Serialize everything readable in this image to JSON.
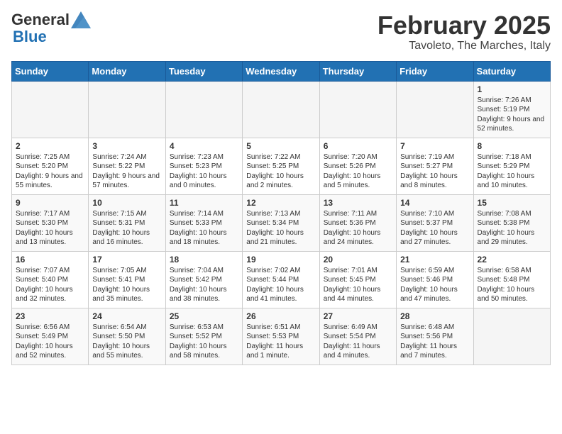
{
  "logo": {
    "general": "General",
    "blue": "Blue"
  },
  "header": {
    "title": "February 2025",
    "subtitle": "Tavoleto, The Marches, Italy"
  },
  "weekdays": [
    "Sunday",
    "Monday",
    "Tuesday",
    "Wednesday",
    "Thursday",
    "Friday",
    "Saturday"
  ],
  "weeks": [
    [
      {
        "day": "",
        "info": ""
      },
      {
        "day": "",
        "info": ""
      },
      {
        "day": "",
        "info": ""
      },
      {
        "day": "",
        "info": ""
      },
      {
        "day": "",
        "info": ""
      },
      {
        "day": "",
        "info": ""
      },
      {
        "day": "1",
        "info": "Sunrise: 7:26 AM\nSunset: 5:19 PM\nDaylight: 9 hours and 52 minutes."
      }
    ],
    [
      {
        "day": "2",
        "info": "Sunrise: 7:25 AM\nSunset: 5:20 PM\nDaylight: 9 hours and 55 minutes."
      },
      {
        "day": "3",
        "info": "Sunrise: 7:24 AM\nSunset: 5:22 PM\nDaylight: 9 hours and 57 minutes."
      },
      {
        "day": "4",
        "info": "Sunrise: 7:23 AM\nSunset: 5:23 PM\nDaylight: 10 hours and 0 minutes."
      },
      {
        "day": "5",
        "info": "Sunrise: 7:22 AM\nSunset: 5:25 PM\nDaylight: 10 hours and 2 minutes."
      },
      {
        "day": "6",
        "info": "Sunrise: 7:20 AM\nSunset: 5:26 PM\nDaylight: 10 hours and 5 minutes."
      },
      {
        "day": "7",
        "info": "Sunrise: 7:19 AM\nSunset: 5:27 PM\nDaylight: 10 hours and 8 minutes."
      },
      {
        "day": "8",
        "info": "Sunrise: 7:18 AM\nSunset: 5:29 PM\nDaylight: 10 hours and 10 minutes."
      }
    ],
    [
      {
        "day": "9",
        "info": "Sunrise: 7:17 AM\nSunset: 5:30 PM\nDaylight: 10 hours and 13 minutes."
      },
      {
        "day": "10",
        "info": "Sunrise: 7:15 AM\nSunset: 5:31 PM\nDaylight: 10 hours and 16 minutes."
      },
      {
        "day": "11",
        "info": "Sunrise: 7:14 AM\nSunset: 5:33 PM\nDaylight: 10 hours and 18 minutes."
      },
      {
        "day": "12",
        "info": "Sunrise: 7:13 AM\nSunset: 5:34 PM\nDaylight: 10 hours and 21 minutes."
      },
      {
        "day": "13",
        "info": "Sunrise: 7:11 AM\nSunset: 5:36 PM\nDaylight: 10 hours and 24 minutes."
      },
      {
        "day": "14",
        "info": "Sunrise: 7:10 AM\nSunset: 5:37 PM\nDaylight: 10 hours and 27 minutes."
      },
      {
        "day": "15",
        "info": "Sunrise: 7:08 AM\nSunset: 5:38 PM\nDaylight: 10 hours and 29 minutes."
      }
    ],
    [
      {
        "day": "16",
        "info": "Sunrise: 7:07 AM\nSunset: 5:40 PM\nDaylight: 10 hours and 32 minutes."
      },
      {
        "day": "17",
        "info": "Sunrise: 7:05 AM\nSunset: 5:41 PM\nDaylight: 10 hours and 35 minutes."
      },
      {
        "day": "18",
        "info": "Sunrise: 7:04 AM\nSunset: 5:42 PM\nDaylight: 10 hours and 38 minutes."
      },
      {
        "day": "19",
        "info": "Sunrise: 7:02 AM\nSunset: 5:44 PM\nDaylight: 10 hours and 41 minutes."
      },
      {
        "day": "20",
        "info": "Sunrise: 7:01 AM\nSunset: 5:45 PM\nDaylight: 10 hours and 44 minutes."
      },
      {
        "day": "21",
        "info": "Sunrise: 6:59 AM\nSunset: 5:46 PM\nDaylight: 10 hours and 47 minutes."
      },
      {
        "day": "22",
        "info": "Sunrise: 6:58 AM\nSunset: 5:48 PM\nDaylight: 10 hours and 50 minutes."
      }
    ],
    [
      {
        "day": "23",
        "info": "Sunrise: 6:56 AM\nSunset: 5:49 PM\nDaylight: 10 hours and 52 minutes."
      },
      {
        "day": "24",
        "info": "Sunrise: 6:54 AM\nSunset: 5:50 PM\nDaylight: 10 hours and 55 minutes."
      },
      {
        "day": "25",
        "info": "Sunrise: 6:53 AM\nSunset: 5:52 PM\nDaylight: 10 hours and 58 minutes."
      },
      {
        "day": "26",
        "info": "Sunrise: 6:51 AM\nSunset: 5:53 PM\nDaylight: 11 hours and 1 minute."
      },
      {
        "day": "27",
        "info": "Sunrise: 6:49 AM\nSunset: 5:54 PM\nDaylight: 11 hours and 4 minutes."
      },
      {
        "day": "28",
        "info": "Sunrise: 6:48 AM\nSunset: 5:56 PM\nDaylight: 11 hours and 7 minutes."
      },
      {
        "day": "",
        "info": ""
      }
    ]
  ]
}
